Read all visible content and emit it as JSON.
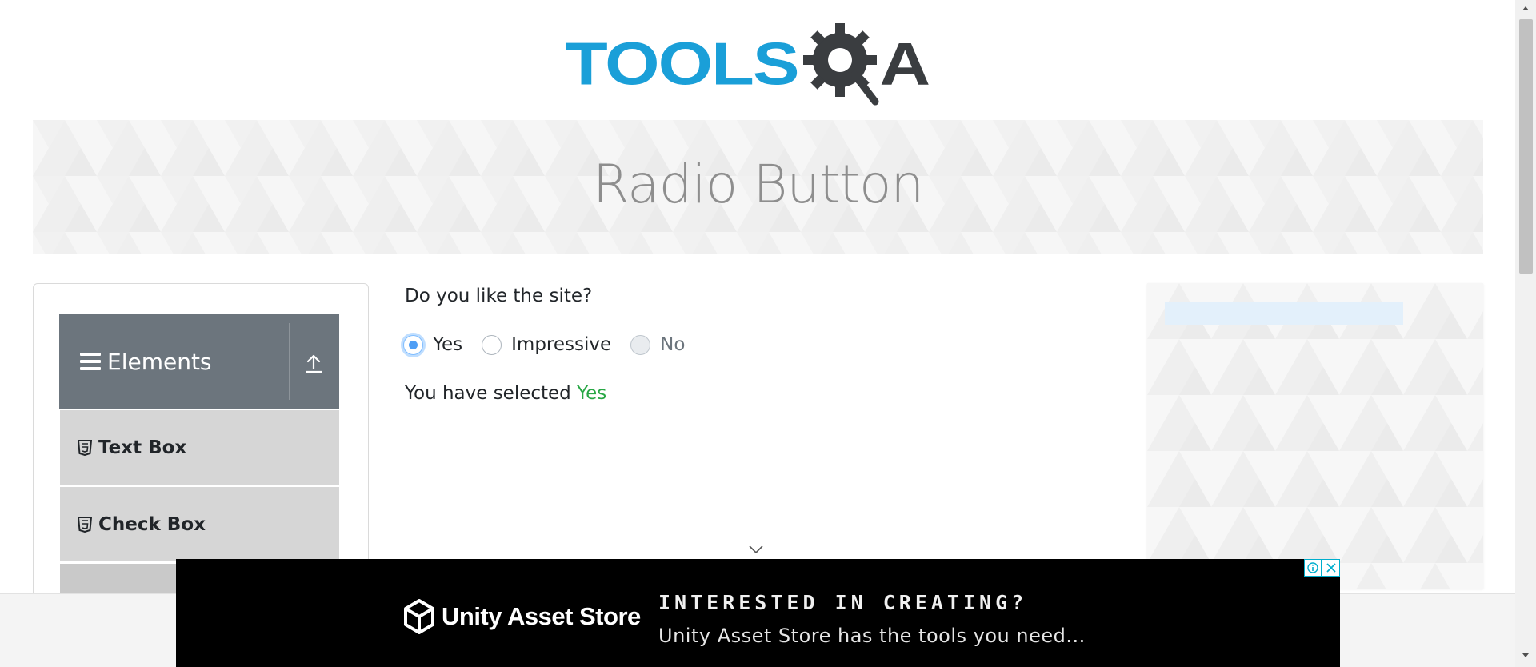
{
  "logo": {
    "text_main": "TOOLS",
    "text_end": "A",
    "brand_color": "#1a9fd8",
    "dark_color": "#3a3d40"
  },
  "banner": {
    "title": "Radio Button"
  },
  "sidebar": {
    "group_title": "Elements",
    "items": [
      {
        "label": "Text Box",
        "icon": "html5-icon"
      },
      {
        "label": "Check Box",
        "icon": "html5-icon"
      }
    ]
  },
  "main": {
    "question": "Do you like the site?",
    "options": [
      {
        "label": "Yes",
        "checked": true,
        "disabled": false
      },
      {
        "label": "Impressive",
        "checked": false,
        "disabled": false
      },
      {
        "label": "No",
        "checked": false,
        "disabled": true
      }
    ],
    "result_prefix": "You have selected",
    "result_value": "Yes"
  },
  "bottom_ad": {
    "brand": "Unity Asset Store",
    "headline": "INTERESTED IN CREATING?",
    "subline": "Unity Asset Store has the tools you need..."
  },
  "colors": {
    "accent": "#28a745",
    "header_bg": "#6c757d",
    "item_bg": "#d6d6d6"
  }
}
